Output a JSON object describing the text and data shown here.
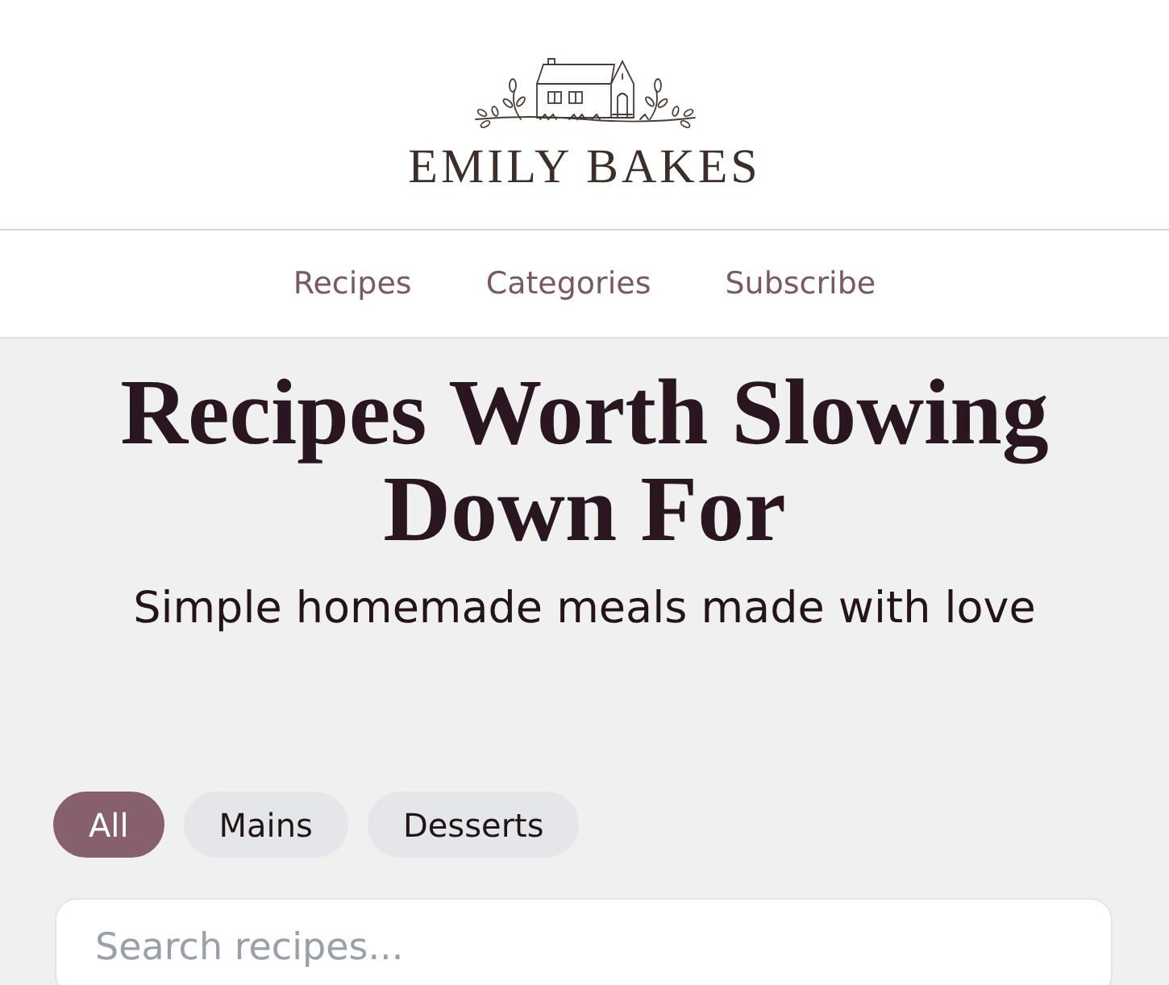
{
  "header": {
    "logo_text": "EMILY BAKES"
  },
  "nav": {
    "items": [
      "Recipes",
      "Categories",
      "Subscribe"
    ]
  },
  "hero": {
    "title": "Recipes Worth Slowing Down For",
    "subtitle": "Simple homemade meals made with love"
  },
  "filters": [
    {
      "label": "All",
      "selected": true
    },
    {
      "label": "Mains",
      "selected": false
    },
    {
      "label": "Desserts",
      "selected": false
    }
  ],
  "search": {
    "placeholder": "Search recipes..."
  }
}
